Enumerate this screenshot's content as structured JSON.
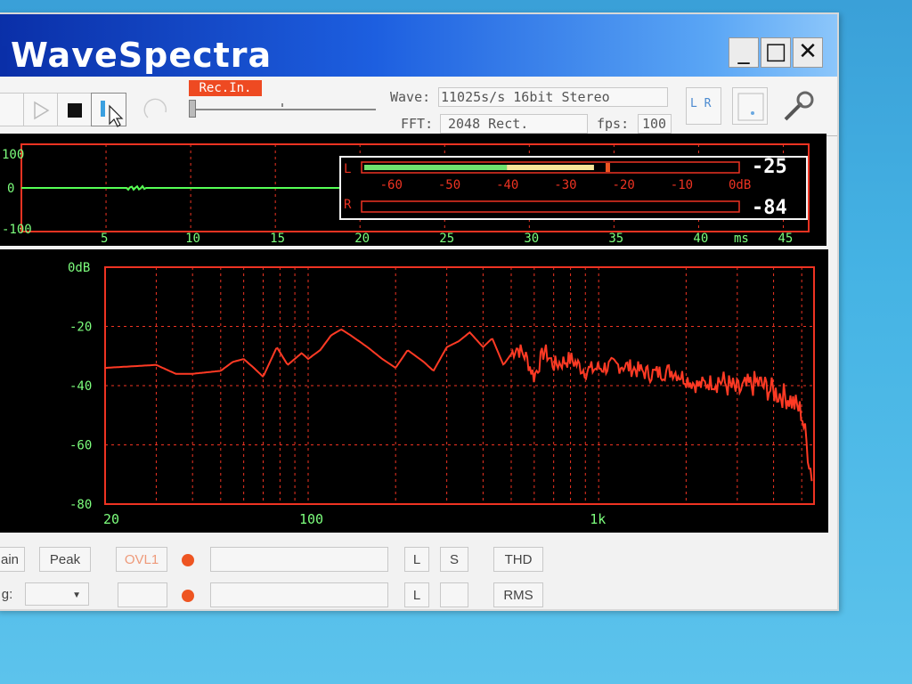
{
  "window": {
    "title": "WaveSpectra",
    "controls": {
      "minimize": "_",
      "maximize": "□",
      "close": "✕"
    }
  },
  "toolbar": {
    "record_input_label": "Rec.In.",
    "wave_label": "Wave:",
    "wave_value": "11025s/s 16bit Stereo",
    "fft_label": "FFT:",
    "fft_value": "2048 Rect.",
    "fps_label": "fps:",
    "fps_value": "100",
    "lr_button_label": "L R"
  },
  "scope": {
    "y_labels": [
      "100",
      "0",
      "-100"
    ],
    "x_ticks": [
      "5",
      "10",
      "15",
      "20",
      "25",
      "30",
      "35",
      "40",
      "45"
    ],
    "x_unit": "ms"
  },
  "level_meter": {
    "channel_left": "L",
    "channel_right": "R",
    "scale": [
      "-60",
      "-50",
      "-40",
      "-30",
      "-20",
      "-10",
      "0dB"
    ],
    "left_db": "-25",
    "right_db": "-84",
    "left_level_db": -25,
    "left_peak_db": -23
  },
  "spectrum": {
    "y_labels": [
      "0dB",
      "-20",
      "-40",
      "-60",
      "-80"
    ],
    "x_labels": [
      "20",
      "100",
      "1k"
    ]
  },
  "bottom": {
    "gain_label": "ain",
    "peak_label": "Peak",
    "ovl_label": "OVL1",
    "l_label_1": "L",
    "s_label": "S",
    "thd_label": "THD",
    "avg_label": "g:",
    "l_label_2": "L",
    "rms_label": "RMS"
  },
  "colors": {
    "grid": "#ee3322",
    "trace": "#ff3a24",
    "green_text": "#7dff7d",
    "scope_line": "#55ff55"
  }
}
